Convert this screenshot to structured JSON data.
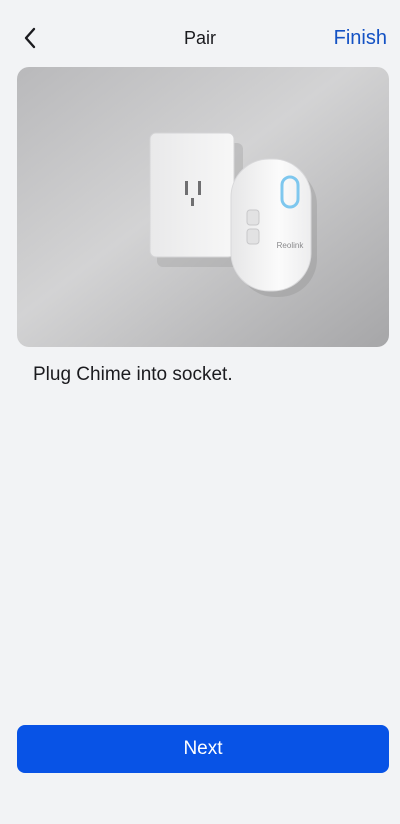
{
  "nav": {
    "title": "Pair",
    "finish_label": "Finish",
    "back_icon": "chevron-left-icon"
  },
  "hero": {
    "brand_text": "Reolink"
  },
  "instruction": "Plug Chime into socket.",
  "next_label": "Next",
  "colors": {
    "accent": "#0853e6",
    "link": "#1452c4",
    "background": "#f2f3f5"
  }
}
